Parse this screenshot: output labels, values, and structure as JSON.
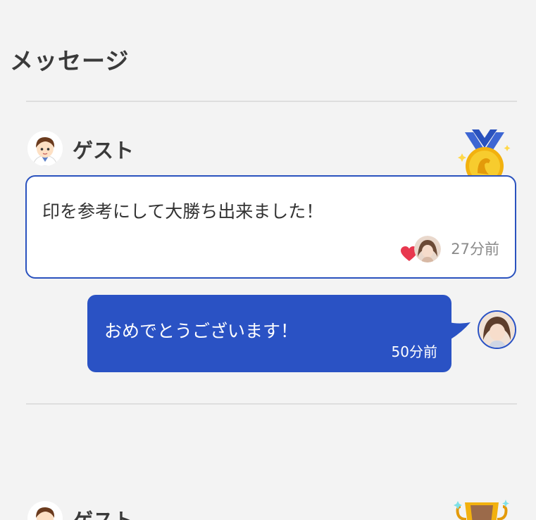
{
  "header": {
    "title": "メッセージ"
  },
  "messages": [
    {
      "user_name": "ゲスト",
      "badge": "gold-medal-icon",
      "text": "印を参考にして大勝ち出来ました！",
      "time": "27分前",
      "reply": {
        "text": "おめでとうございます！",
        "time": "50分前"
      }
    },
    {
      "user_name": "ゲスト",
      "badge": "trophy-icon"
    }
  ],
  "colors": {
    "accent": "#2a52c4",
    "background": "#f3f3f3",
    "divider": "#dedede",
    "heart": "#e8384f",
    "medal_gold": "#f5c518",
    "ribbon": "#2a52be"
  }
}
